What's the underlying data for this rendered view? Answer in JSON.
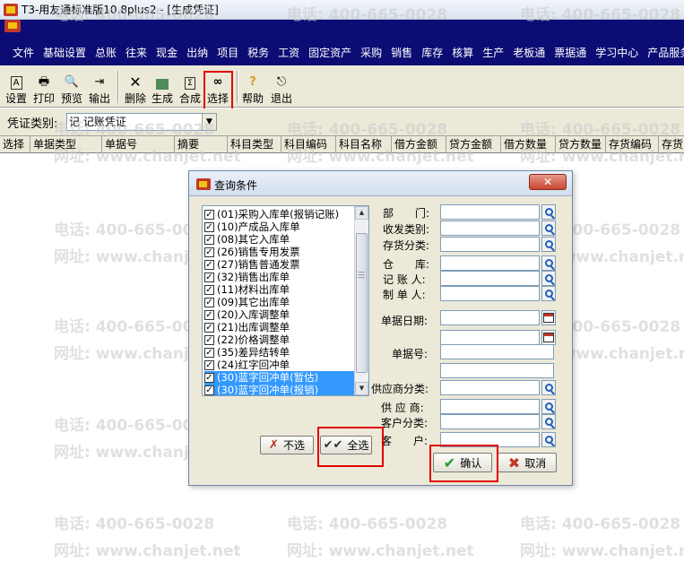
{
  "window": {
    "title": "T3-用友通标准版10.8plus2 - [生成凭证]"
  },
  "menu": [
    "文件",
    "基础设置",
    "总账",
    "往来",
    "现金",
    "出纳",
    "项目",
    "税务",
    "工资",
    "固定资产",
    "采购",
    "销售",
    "库存",
    "核算",
    "生产",
    "老板通",
    "票据通",
    "学习中心",
    "产品服务"
  ],
  "toolbar": {
    "settings": "设置",
    "print": "打印",
    "preview": "预览",
    "export": "输出",
    "delete": "删除",
    "generate": "生成",
    "merge": "合成",
    "select": "选择",
    "help": "帮助",
    "exit": "退出"
  },
  "voucher": {
    "label": "凭证类别:",
    "value": "记 记账凭证"
  },
  "columns": [
    "选择",
    "单据类型",
    "单据号",
    "摘要",
    "科目类型",
    "科目编码",
    "科目名称",
    "借方金额",
    "贷方金额",
    "借方数量",
    "贷方数量",
    "存货编码",
    "存货"
  ],
  "watermark": {
    "phone": "电话: 400-665-0028",
    "site": "网址: www.chanjet.net"
  },
  "dialog": {
    "title": "查询条件",
    "close": "✕",
    "doc_types": [
      {
        "label": "(01)采购入库单(报销记账)",
        "checked": true,
        "selected": false
      },
      {
        "label": "(10)产成品入库单",
        "checked": true,
        "selected": false
      },
      {
        "label": "(08)其它入库单",
        "checked": true,
        "selected": false
      },
      {
        "label": "(26)销售专用发票",
        "checked": true,
        "selected": false
      },
      {
        "label": "(27)销售普通发票",
        "checked": true,
        "selected": false
      },
      {
        "label": "(32)销售出库单",
        "checked": true,
        "selected": false
      },
      {
        "label": "(11)材料出库单",
        "checked": true,
        "selected": false
      },
      {
        "label": "(09)其它出库单",
        "checked": true,
        "selected": false
      },
      {
        "label": "(20)入库调整单",
        "checked": true,
        "selected": false
      },
      {
        "label": "(21)出库调整单",
        "checked": true,
        "selected": false
      },
      {
        "label": "(22)价格调整单",
        "checked": true,
        "selected": false
      },
      {
        "label": "(35)差异结转单",
        "checked": true,
        "selected": false
      },
      {
        "label": "(24)红字回冲单",
        "checked": true,
        "selected": false
      },
      {
        "label": "(30)蓝字回冲单(暂估)",
        "checked": true,
        "selected": true
      },
      {
        "label": "(30)蓝字回冲单(报销)",
        "checked": true,
        "selected": true
      }
    ],
    "fields": {
      "dept": "部　　门:",
      "issue_type": "收发类别:",
      "inv_class": "存货分类:",
      "warehouse": "仓　　库:",
      "bookkeeper": "记 账 人:",
      "maker": "制 单 人:",
      "doc_date": "单据日期:",
      "doc_no": "单据号:",
      "supplier_class": "供应商分类:",
      "supplier": "供 应 商:",
      "customer_class": "客户分类:",
      "customer": "客　　户:"
    },
    "buttons": {
      "deselect_all": "不选",
      "select_all": "全选",
      "confirm": "确认",
      "cancel": "取消"
    }
  }
}
